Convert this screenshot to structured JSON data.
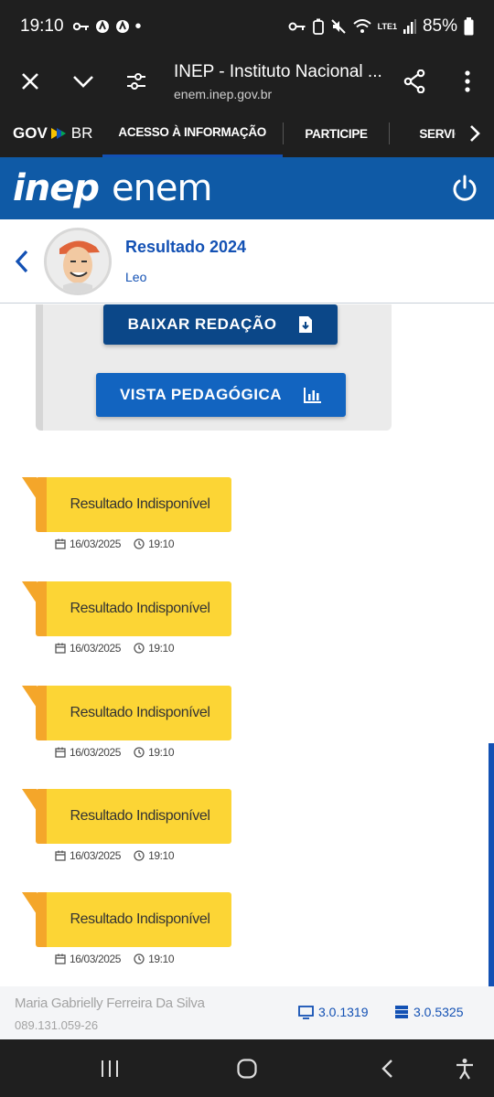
{
  "status_bar": {
    "time": "19:10",
    "battery": "85%",
    "network": "LTE1"
  },
  "browser": {
    "title": "INEP - Instituto Nacional ...",
    "url": "enem.inep.gov.br"
  },
  "gov_bar": {
    "logo_gov": "GOV",
    "logo_br": "BR",
    "tabs": [
      "ACESSO À INFORMAÇÃO",
      "PARTICIPE",
      "SERVIÇOS"
    ]
  },
  "header": {
    "inep": "inep",
    "enem": "enem"
  },
  "result_header": {
    "title": "Resultado 2024",
    "user": "Leo"
  },
  "actions": {
    "baixar_label": "BAIXAR REDAÇÃO",
    "vista_label": "VISTA PEDAGÓGICA"
  },
  "notifications": [
    {
      "text": "Resultado Indisponível",
      "date": "16/03/2025",
      "time": "19:10"
    },
    {
      "text": "Resultado Indisponível",
      "date": "16/03/2025",
      "time": "19:10"
    },
    {
      "text": "Resultado Indisponível",
      "date": "16/03/2025",
      "time": "19:10"
    },
    {
      "text": "Resultado Indisponível",
      "date": "16/03/2025",
      "time": "19:10"
    },
    {
      "text": "Resultado Indisponível",
      "date": "16/03/2025",
      "time": "19:10"
    }
  ],
  "footer": {
    "name": "Maria Gabrielly Ferreira Da Silva",
    "cpf": "089.131.059-26",
    "front_version": "3.0.1319",
    "back_version": "3.0.5325"
  },
  "colors": {
    "brand_blue": "#1351b4",
    "header_blue": "#0f5aa6",
    "notif_yellow": "#fcd535",
    "notif_orange": "#f4a62a"
  }
}
